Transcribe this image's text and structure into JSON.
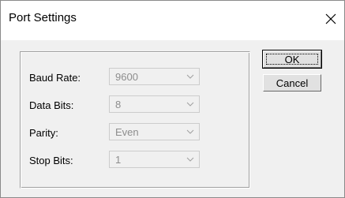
{
  "window": {
    "title": "Port Settings",
    "close_icon": "close-icon"
  },
  "fields": [
    {
      "label": "Baud Rate:",
      "value": "9600"
    },
    {
      "label": "Data Bits:",
      "value": "8"
    },
    {
      "label": "Parity:",
      "value": "Even"
    },
    {
      "label": "Stop Bits:",
      "value": "1"
    }
  ],
  "buttons": {
    "ok_label": "OK",
    "cancel_label": "Cancel"
  },
  "colors": {
    "dialog_bg": "#f0f0f0",
    "titlebar_bg": "#ffffff",
    "disabled_text": "#8d8d8d"
  }
}
